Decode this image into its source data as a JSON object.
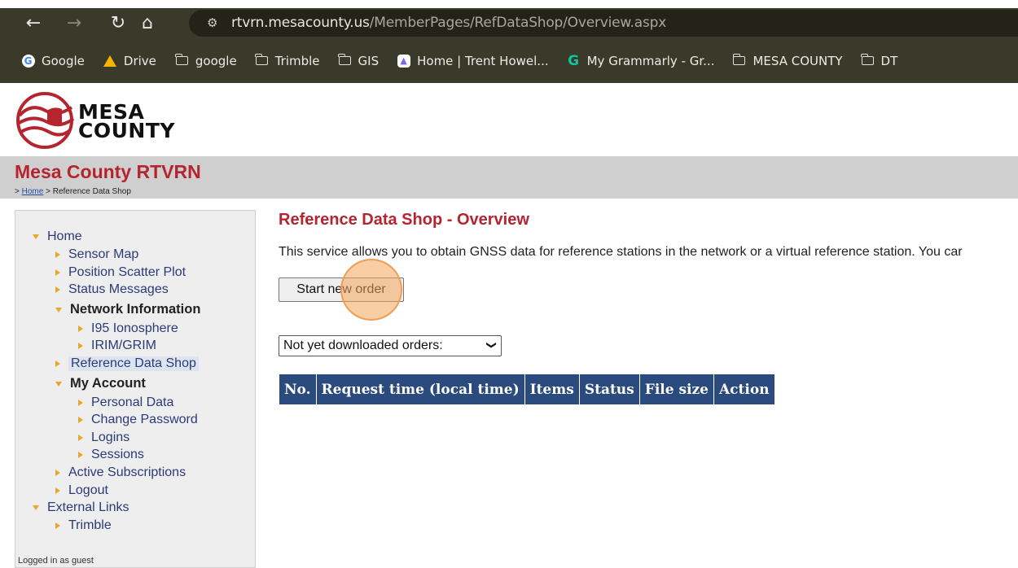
{
  "browser": {
    "url_domain": "rtvrn.mesacounty.us",
    "url_path": "/MemberPages/RefDataShop/Overview.aspx",
    "bookmarks": [
      {
        "label": "Google",
        "icon": "google-icon"
      },
      {
        "label": "Drive",
        "icon": "drive-icon"
      },
      {
        "label": "google",
        "icon": "folder-icon"
      },
      {
        "label": "Trimble",
        "icon": "folder-icon"
      },
      {
        "label": "GIS",
        "icon": "folder-icon"
      },
      {
        "label": "Home | Trent Howel...",
        "icon": "clickup-icon"
      },
      {
        "label": "My Grammarly - Gr...",
        "icon": "grammarly-icon"
      },
      {
        "label": "MESA COUNTY",
        "icon": "folder-icon"
      },
      {
        "label": "DT",
        "icon": "folder-icon"
      }
    ]
  },
  "logo": {
    "line1": "MESA",
    "line2": "COUNTY"
  },
  "header": {
    "site_title": "Mesa County RTVRN",
    "breadcrumb_prefix": ">",
    "breadcrumb_home": "Home",
    "breadcrumb_sep": ">",
    "breadcrumb_current": "Reference Data Shop"
  },
  "sidebar": {
    "items": [
      {
        "label": "Home",
        "level": 0,
        "expanded": true
      },
      {
        "label": "Sensor Map",
        "level": 1
      },
      {
        "label": "Position Scatter Plot",
        "level": 1
      },
      {
        "label": "Status Messages",
        "level": 1
      },
      {
        "label": "Network Information",
        "level": 1,
        "expanded": true
      },
      {
        "label": "I95 Ionosphere",
        "level": 2
      },
      {
        "label": "IRIM/GRIM",
        "level": 2
      },
      {
        "label": "Reference Data Shop",
        "level": 1,
        "selected": true
      },
      {
        "label": "My Account",
        "level": 1,
        "expanded": true
      },
      {
        "label": "Personal Data",
        "level": 2
      },
      {
        "label": "Change Password",
        "level": 2
      },
      {
        "label": "Logins",
        "level": 2
      },
      {
        "label": "Sessions",
        "level": 2
      },
      {
        "label": "Active Subscriptions",
        "level": 1
      },
      {
        "label": "Logout",
        "level": 1
      },
      {
        "label": "External Links",
        "level": 0,
        "expanded": true
      },
      {
        "label": "Trimble",
        "level": 1
      }
    ],
    "logged_in_text": "Logged in as guest"
  },
  "main": {
    "title": "Reference Data Shop - Overview",
    "intro": "This service allows you to obtain GNSS data for reference stations in the network or a virtual reference station. You car",
    "start_button": "Start new order",
    "order_filter": "Not yet downloaded orders:",
    "table_headers": [
      "No.",
      "Request time (local time)",
      "Items",
      "Status",
      "File size",
      "Action"
    ]
  },
  "colors": {
    "brand_red": "#b5252f",
    "table_header": "#2b4a7e",
    "link_blue": "#2c3a78",
    "bullet_orange": "#e7a72b"
  }
}
